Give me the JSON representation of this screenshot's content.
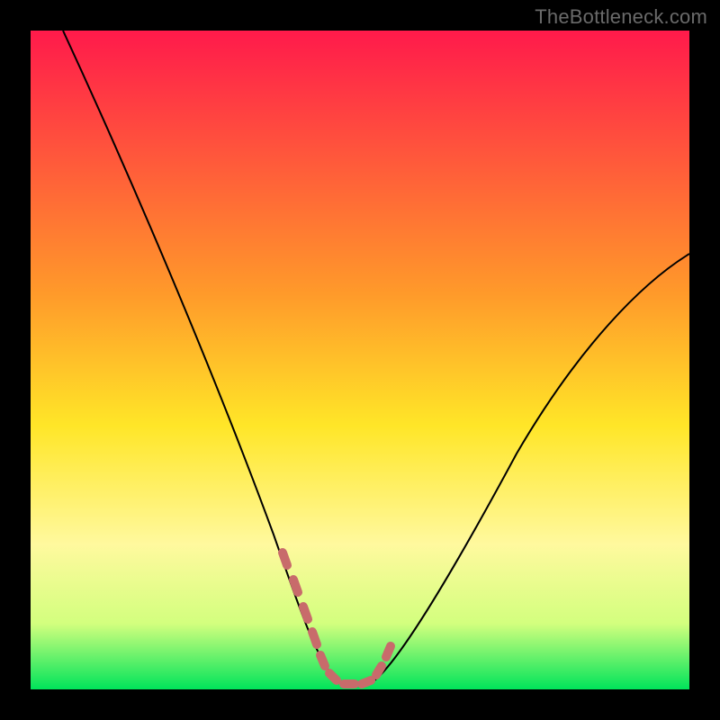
{
  "watermark": "TheBottleneck.com",
  "chart_data": {
    "type": "line",
    "title": "",
    "xlabel": "",
    "ylabel": "",
    "xlim": [
      0,
      100
    ],
    "ylim": [
      0,
      100
    ],
    "grid": false,
    "legend": false,
    "background_gradient_stops": [
      {
        "offset": 0,
        "color": "#ff1a4b"
      },
      {
        "offset": 40,
        "color": "#ff9a2a"
      },
      {
        "offset": 60,
        "color": "#ffe628"
      },
      {
        "offset": 78,
        "color": "#fff99e"
      },
      {
        "offset": 90,
        "color": "#d3ff7e"
      },
      {
        "offset": 100,
        "color": "#00e45a"
      }
    ],
    "series": [
      {
        "name": "bottleneck-curve",
        "stroke": "#000000",
        "stroke_width": 2,
        "x": [
          5,
          10,
          15,
          20,
          25,
          30,
          35,
          38,
          42,
          44,
          46,
          48,
          52,
          55,
          60,
          65,
          70,
          75,
          80,
          85,
          90,
          95,
          100
        ],
        "y": [
          100,
          88,
          77,
          66,
          55,
          44,
          31,
          20,
          8,
          4,
          2,
          1,
          1,
          5,
          12,
          20,
          28,
          35,
          42,
          49,
          55,
          61,
          66
        ]
      },
      {
        "name": "optimal-zone-marker",
        "stroke": "#c86b6b",
        "stroke_width": 10,
        "stroke_linecap": "round",
        "dotted": true,
        "x": [
          38,
          40,
          42,
          44,
          46,
          48,
          50,
          52,
          54,
          55
        ],
        "y": [
          20,
          13,
          8,
          4,
          2,
          1,
          1,
          1,
          3,
          5
        ]
      }
    ],
    "optimal_x_range": [
      44,
      52
    ],
    "curve_minimum": {
      "x": 49,
      "y": 1
    }
  }
}
